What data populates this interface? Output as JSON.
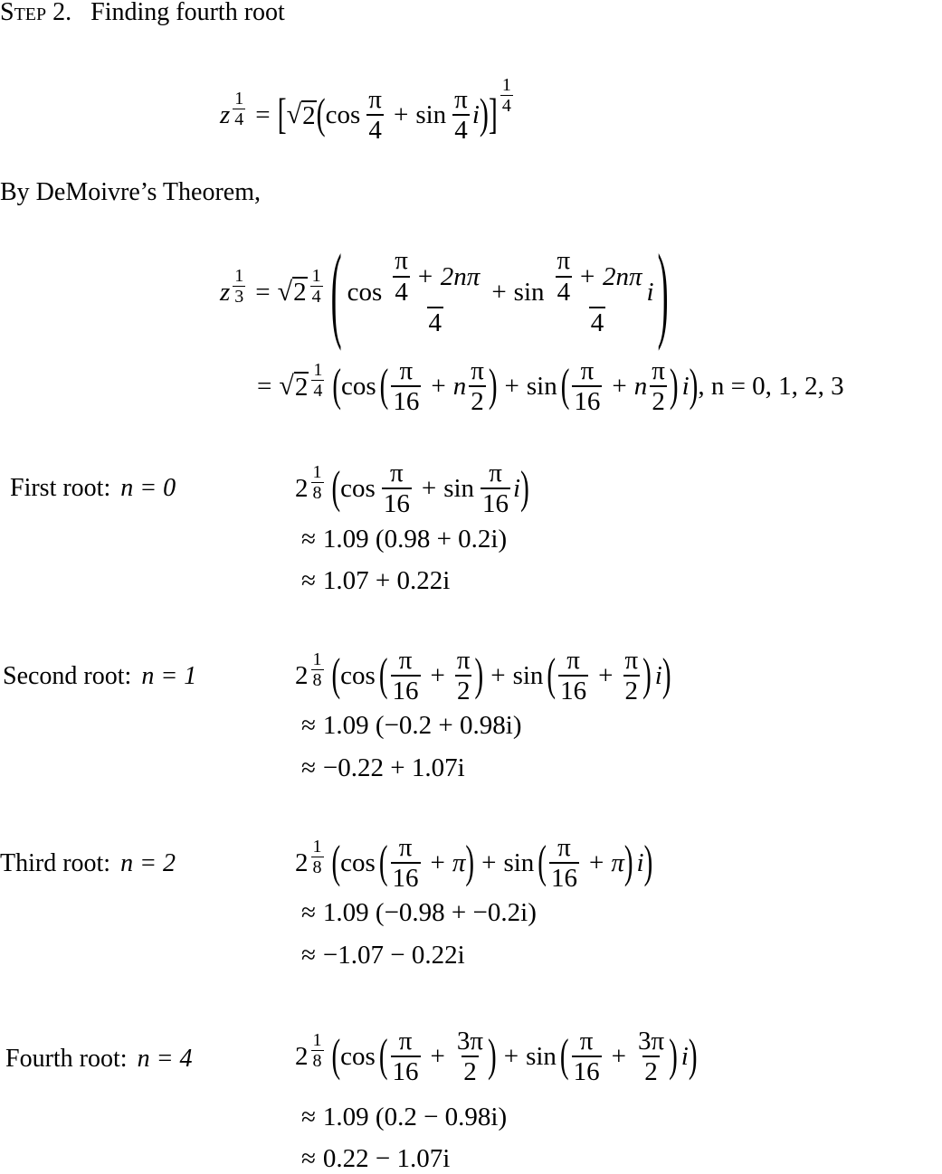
{
  "heading": {
    "step_label": "Step 2.",
    "title": "Finding fourth root"
  },
  "eq1": {
    "lhs": "z",
    "lhs_exp": [
      "1",
      "4"
    ],
    "sqrt_radicand": "2",
    "cos": "cos",
    "sin": "sin",
    "angle": [
      "π",
      "4"
    ],
    "imag": "i",
    "outer_exp": [
      "1",
      "4"
    ]
  },
  "intro_text": "By DeMoivre’s Theorem,",
  "eq2": {
    "line1": {
      "lhs": "z",
      "lhs_exp": [
        "1",
        "3"
      ],
      "sqrt_radicand": "2",
      "sqrt_exp": [
        "1",
        "4"
      ],
      "cos": "cos",
      "sin": "sin",
      "inner_num_frac": [
        "π",
        "4"
      ],
      "inner_num_rest": "+ 2nπ",
      "den": "4",
      "imag": "i"
    },
    "line2": {
      "sqrt_radicand": "2",
      "sqrt_exp": [
        "1",
        "4"
      ],
      "cos": "cos",
      "sin": "sin",
      "frac_a": [
        "π",
        "16"
      ],
      "n": "n",
      "frac_b": [
        "π",
        "2"
      ],
      "imag": "i",
      "n_values": ", n = 0, 1, 2, 3"
    }
  },
  "roots": [
    {
      "label": "First root:",
      "n_expr": "n = 0",
      "base": "2",
      "base_exp": [
        "1",
        "8"
      ],
      "angle_a": [
        "π",
        "16"
      ],
      "angle_b": null,
      "approx1": "1.09 (0.98 + 0.2i)",
      "approx2": "1.07 + 0.22i"
    },
    {
      "label": "Second root:",
      "n_expr": "n = 1",
      "base": "2",
      "base_exp": [
        "1",
        "8"
      ],
      "angle_a": [
        "π",
        "16"
      ],
      "angle_b": [
        "π",
        "2"
      ],
      "approx1": "1.09 (−0.2 + 0.98i)",
      "approx2": "−0.22 + 1.07i"
    },
    {
      "label": "Third root:",
      "n_expr": "n = 2",
      "base": "2",
      "base_exp": [
        "1",
        "8"
      ],
      "angle_a": [
        "π",
        "16"
      ],
      "angle_b_plain": "π",
      "approx1": "1.09 (−0.98 + −0.2i)",
      "approx2": "−1.07 − 0.22i"
    },
    {
      "label": "Fourth root:",
      "n_expr": "n = 4",
      "base": "2",
      "base_exp": [
        "1",
        "8"
      ],
      "angle_a": [
        "π",
        "16"
      ],
      "angle_b": [
        "3π",
        "2"
      ],
      "approx1": "1.09 (0.2 − 0.98i)",
      "approx2": "0.22 − 1.07i"
    }
  ],
  "symbols": {
    "approx": "≈",
    "equals": "=",
    "plus": "+",
    "lparen": "(",
    "rparen": ")",
    "lbrack": "[",
    "rbrack": "]",
    "radical": "√"
  }
}
